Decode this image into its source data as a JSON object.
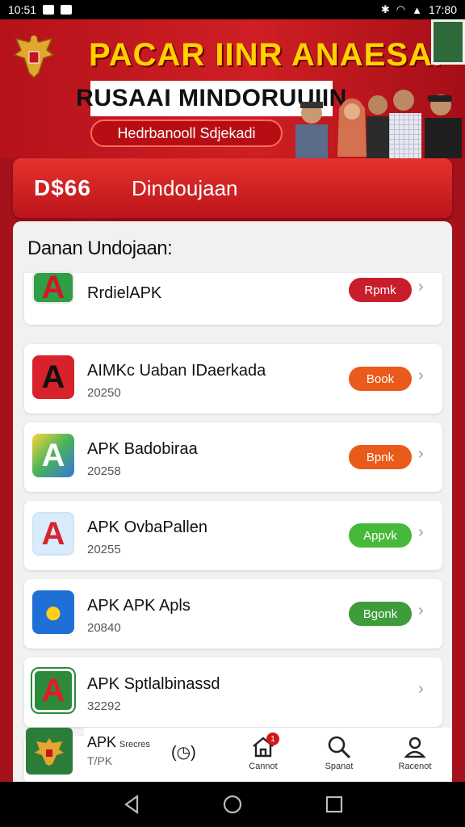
{
  "status_bar": {
    "time": "10:51",
    "battery": "17:80"
  },
  "banner": {
    "title": "PACAR IINR ANAESAI",
    "subtitle": "RUSAAI MINDORUUIIN",
    "pill": "Hedrbanooll Sdjekadi"
  },
  "header": {
    "code": "D$66",
    "title": "Dindoujaan"
  },
  "section_title": "Danan Undojaan:",
  "items": [
    {
      "name": "RrdielAPK",
      "year": "",
      "tag": "Rpmk",
      "tag_color": "#c81e2c",
      "icon": "green-a-icon"
    },
    {
      "name": "AIMKc Uaban IDaerkada",
      "year": "20250",
      "tag": "Book",
      "tag_color": "#ea5a1a",
      "icon": "red-a-icon"
    },
    {
      "name": "APK Badobiraa",
      "year": "20258",
      "tag": "Bpnk",
      "tag_color": "#ea5a1a",
      "icon": "rainbow-a-icon"
    },
    {
      "name": "APK OvbaPallen",
      "year": "20255",
      "tag": "Appvk",
      "tag_color": "#46b83a",
      "icon": "blue-a-icon"
    },
    {
      "name": "APK APK Apls",
      "year": "20840",
      "tag": "Bgonk",
      "tag_color": "#3f9c3a",
      "icon": "blue-circle-icon"
    },
    {
      "name": "APK Sptlalbinassd",
      "year": "32292",
      "tag": "",
      "tag_color": "",
      "icon": "green-red-a-icon"
    }
  ],
  "bottom_item": {
    "name": "APK",
    "small": "Srecres",
    "year": "T/PK"
  },
  "bottom_nav": [
    {
      "label": "Cannot",
      "icon": "home-icon",
      "badge": "1"
    },
    {
      "label": "Spanat",
      "icon": "search-icon",
      "badge": ""
    },
    {
      "label": "Racenot",
      "icon": "profile-icon",
      "badge": ""
    }
  ]
}
